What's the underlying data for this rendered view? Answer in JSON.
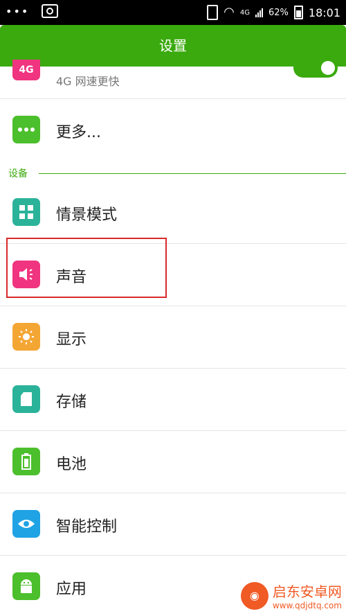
{
  "status_bar": {
    "time": "18:01",
    "battery": "62%",
    "network": "4G",
    "icons": [
      "overflow-dots-icon",
      "screenshot-icon",
      "vibrate-icon",
      "wifi-icon",
      "signal-icon",
      "battery-icon"
    ]
  },
  "header": {
    "title": "设置"
  },
  "items": {
    "partial_4g": {
      "icon_text": "4G",
      "subtitle": "4G 网速更快"
    },
    "more": {
      "label": "更多..."
    },
    "scenes": {
      "label": "情景模式"
    },
    "sound": {
      "label": "声音"
    },
    "display": {
      "label": "显示"
    },
    "storage": {
      "label": "存储"
    },
    "battery": {
      "label": "电池"
    },
    "smart": {
      "label": "智能控制"
    },
    "apps": {
      "label": "应用"
    }
  },
  "sections": {
    "device": "设备"
  },
  "watermark": {
    "name": "启东安卓网",
    "url": "www.qdjdtq.com"
  },
  "colors": {
    "accent": "#3aaa0e",
    "highlight": "#d8292b",
    "pink": "#f0347f",
    "teal": "#2bb39a",
    "orange": "#f4a634",
    "green_icon": "#4cbf2c",
    "blue_icon": "#1fa3e4"
  }
}
